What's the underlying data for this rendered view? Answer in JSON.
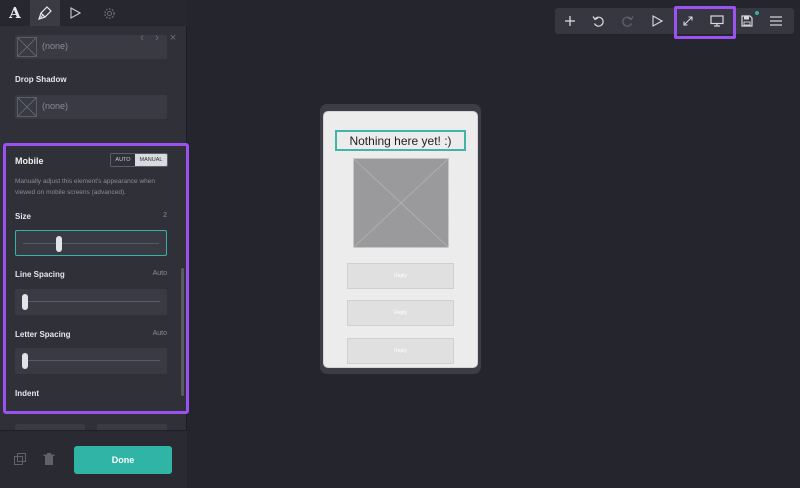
{
  "sidebar": {
    "tabs": [
      {
        "icon": "text-icon",
        "glyph": "A"
      },
      {
        "icon": "brush-icon"
      },
      {
        "icon": "play-icon"
      },
      {
        "icon": "gear-icon"
      }
    ],
    "top_field": {
      "value": "(none)"
    },
    "drop_shadow": {
      "label": "Drop Shadow",
      "value": "(none)"
    },
    "mobile": {
      "title": "Mobile",
      "mode_auto": "AUTO",
      "mode_manual": "MANUAL",
      "selected_mode": "MANUAL",
      "description": "Manually adjust this element's appearance when viewed on mobile screens (advanced).",
      "size": {
        "label": "Size",
        "value": "2",
        "slider_fraction": 0.25
      },
      "line_spacing": {
        "label": "Line Spacing",
        "value": "Auto",
        "slider_fraction": 0
      },
      "letter_spacing": {
        "label": "Letter Spacing",
        "value": "Auto",
        "slider_fraction": 0
      },
      "indent": {
        "label": "Indent"
      }
    },
    "done_label": "Done"
  },
  "toolbar": {
    "buttons": [
      "add-icon",
      "undo-icon",
      "redo-icon",
      "preview-play-icon",
      "fullscreen-icon",
      "desktop-icon",
      "save-icon",
      "menu-icon"
    ]
  },
  "canvas": {
    "heading": "Nothing here yet! :)",
    "buttons": [
      "Reply",
      "Reply",
      "Reply"
    ]
  },
  "colors": {
    "accent": "#2fb4a6",
    "highlight": "#9a52f0",
    "sidebar_bg": "#2f3038",
    "canvas_bg": "#24252d"
  }
}
